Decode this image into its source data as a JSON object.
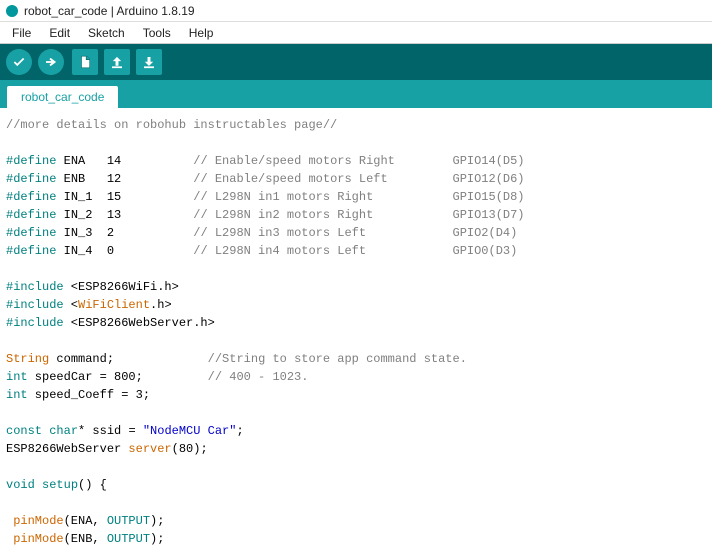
{
  "titlebar": {
    "title": "robot_car_code | Arduino 1.8.19"
  },
  "menubar": {
    "file": "File",
    "edit": "Edit",
    "sketch": "Sketch",
    "tools": "Tools",
    "help": "Help"
  },
  "tabs": {
    "main": "robot_car_code"
  },
  "code": {
    "l1a": "//more details on robohub instructables page//",
    "def": "#define",
    "ena": " ENA   14          ",
    "ena_c": "// Enable/speed motors Right        GPIO14(D5)",
    "enb": " ENB   12          ",
    "enb_c": "// Enable/speed motors Left         GPIO12(D6)",
    "in1": " IN_1  15          ",
    "in1_c": "// L298N in1 motors Right           GPIO15(D8)",
    "in2": " IN_2  13          ",
    "in2_c": "// L298N in2 motors Right           GPIO13(D7)",
    "in3": " IN_3  2           ",
    "in3_c": "// L298N in3 motors Left            GPIO2(D4)",
    "in4": " IN_4  0           ",
    "in4_c": "// L298N in4 motors Left            GPIO0(D3)",
    "inc": "#include",
    "lt": " <",
    "gt": ">",
    "wifi": "ESP8266WiFi",
    "wificlient": "WiFiClient",
    "webserver": "ESP8266WebServer",
    "doth": ".h",
    "string_t": "String",
    "cmd": " command;             ",
    "cmd_c": "//String to store app command state.",
    "int_t": "int",
    "speedcar": " speedCar = 800;         ",
    "speedcar_c": "// 400 - 1023.",
    "speedcoeff": " speed_Coeff = 3;",
    "const_t": "const",
    "char_t": " char",
    "ssid": "* ssid = ",
    "ssid_v": "\"NodeMCU Car\"",
    "semi": ";",
    "srv1": "ESP8266WebServer ",
    "srv2": "server",
    "srv3": "(80);",
    "void_t": "void",
    "setup_n": " setup",
    "setup_p": "() {",
    "pm": " pinMode",
    "pm_ena": "(ENA, ",
    "pm_enb": "(ENB, ",
    "output": "OUTPUT",
    "close": ");"
  }
}
